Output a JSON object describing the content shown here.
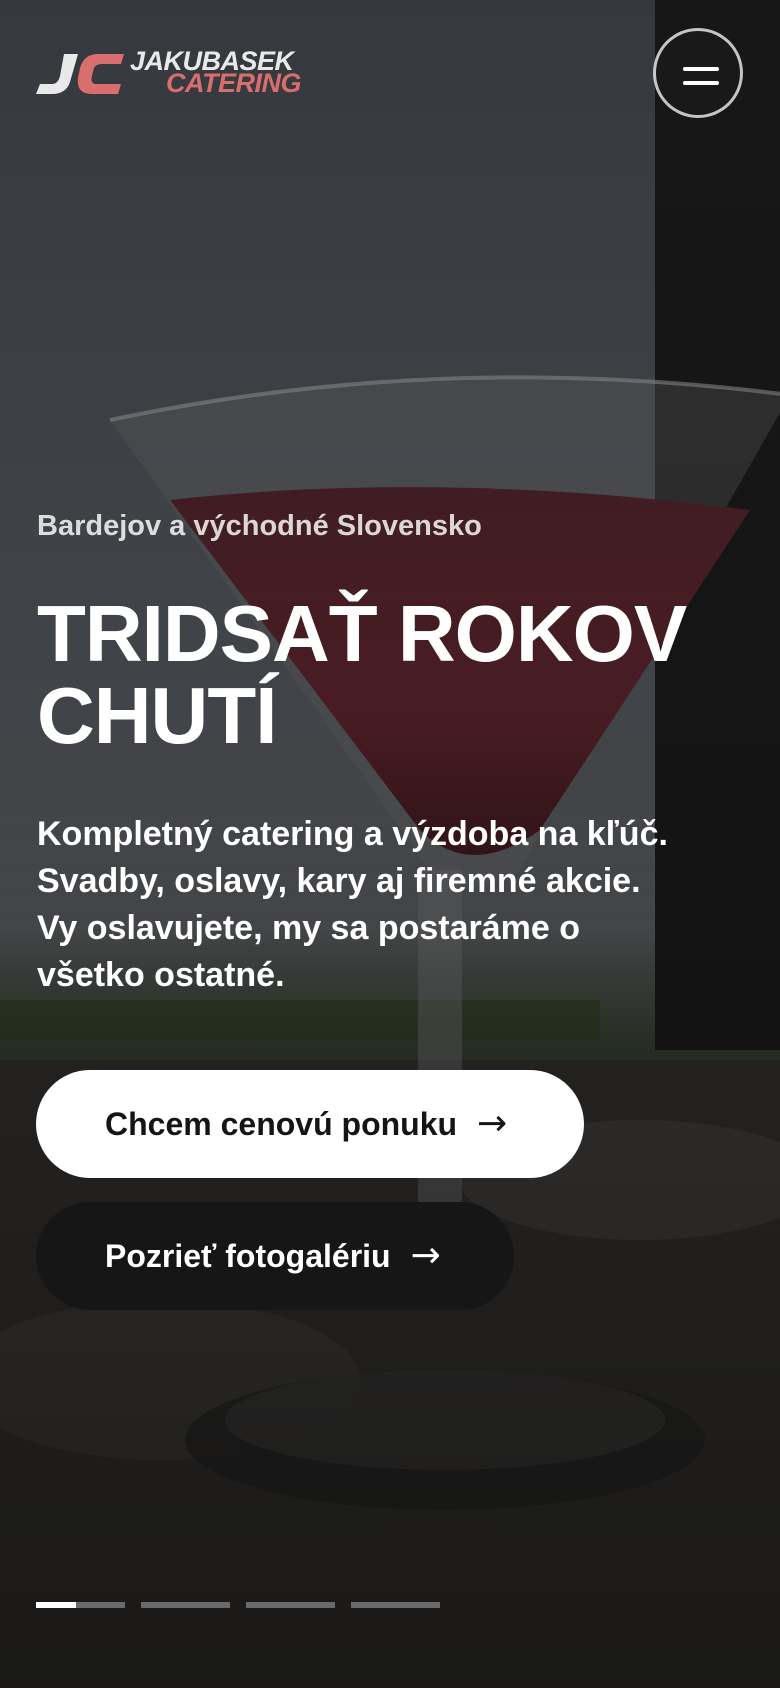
{
  "logo": {
    "line1": "JAKUBASEK",
    "line2": "CATERING",
    "accent_color": "#d86e6e",
    "mark_color": "#e9e9e9"
  },
  "menu": {
    "icon": "hamburger-menu-icon"
  },
  "hero": {
    "location": "Bardejov a východné Slovensko",
    "headline_lines": [
      "TRIDSAŤ ROKOV",
      "CHUTÍ"
    ],
    "lead_lines": [
      "Kompletný catering a výzdoba na kľúč.",
      "Svadby, oslavy, kary aj firemné akcie.",
      "Vy oslavujete, my sa postaráme o",
      "všetko ostatné."
    ],
    "primary_button": {
      "label": "Chcem cenovú ponuku",
      "arrow": "→"
    },
    "secondary_button": {
      "label": "Pozrieť fotogalériu",
      "arrow": "→"
    }
  },
  "slider": {
    "slides": 4,
    "active_index": 0,
    "active_progress": 0.45
  },
  "colors": {
    "overlay": "#1a1a1a",
    "primary_button_bg": "#ffffff",
    "secondary_button_bg": "#161616"
  }
}
